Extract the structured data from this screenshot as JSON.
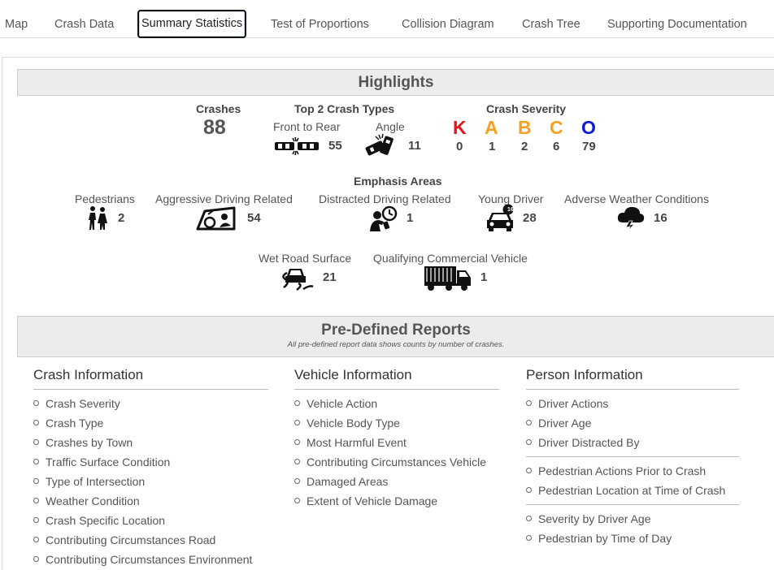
{
  "tabs": [
    {
      "label": "Map"
    },
    {
      "label": "Crash Data"
    },
    {
      "label": "Summary Statistics",
      "active": true
    },
    {
      "label": "Test of Proportions"
    },
    {
      "label": "Collision Diagram"
    },
    {
      "label": "Crash Tree"
    },
    {
      "label": "Supporting Documentation"
    }
  ],
  "highlights": {
    "title": "Highlights",
    "crashes_label": "Crashes",
    "crashes_value": "88",
    "top2_label": "Top 2 Crash Types",
    "types": [
      {
        "label": "Front to Rear",
        "value": "55",
        "icon": "front-to-rear-icon"
      },
      {
        "label": "Angle",
        "value": "11",
        "icon": "angle-crash-icon"
      }
    ],
    "severity_label": "Crash Severity",
    "severity": [
      {
        "letter": "K",
        "value": "0",
        "color": "#e8121a"
      },
      {
        "letter": "A",
        "value": "1",
        "color": "#f7a11e"
      },
      {
        "letter": "B",
        "value": "2",
        "color": "#f7a11e"
      },
      {
        "letter": "C",
        "value": "6",
        "color": "#f7a11e"
      },
      {
        "letter": "O",
        "value": "79",
        "color": "#1018d8"
      }
    ],
    "emphasis_label": "Emphasis Areas",
    "emphasis": [
      {
        "label": "Pedestrians",
        "value": "2",
        "icon": "pedestrians-icon"
      },
      {
        "label": "Aggressive Driving Related",
        "value": "54",
        "icon": "aggressive-driving-icon"
      },
      {
        "label": "Distracted Driving Related",
        "value": "1",
        "icon": "distracted-driving-icon"
      },
      {
        "label": "Young Driver",
        "value": "28",
        "icon": "young-driver-icon"
      },
      {
        "label": "Adverse Weather Conditions",
        "value": "16",
        "icon": "adverse-weather-icon"
      },
      {
        "label": "Wet Road Surface",
        "value": "21",
        "icon": "wet-road-icon"
      },
      {
        "label": "Qualifying Commercial Vehicle",
        "value": "1",
        "icon": "commercial-vehicle-icon"
      }
    ],
    "young_driver_badge": "16"
  },
  "reports": {
    "title": "Pre-Defined Reports",
    "subtitle": "All pre-defined report data shows counts by number of crashes.",
    "columns": [
      {
        "title": "Crash Information",
        "groups": [
          [
            "Crash Severity",
            "Crash Type",
            "Crashes by Town",
            "Traffic Surface Condition",
            "Type of Intersection",
            "Weather Condition",
            "Crash Specific Location",
            "Contributing Circumstances Road",
            "Contributing Circumstances Environment"
          ]
        ]
      },
      {
        "title": "Vehicle Information",
        "groups": [
          [
            "Vehicle Action",
            "Vehicle Body Type",
            "Most Harmful Event",
            "Contributing Circumstances Vehicle",
            "Damaged Areas",
            "Extent of Vehicle Damage"
          ]
        ]
      },
      {
        "title": "Person Information",
        "groups": [
          [
            "Driver Actions",
            "Driver Age",
            "Driver Distracted By"
          ],
          [
            "Pedestrian Actions Prior to Crash",
            "Pedestrian Location at Time of Crash"
          ],
          [
            "Severity by Driver Age",
            "Pedestrian by Time of Day"
          ]
        ]
      }
    ]
  }
}
